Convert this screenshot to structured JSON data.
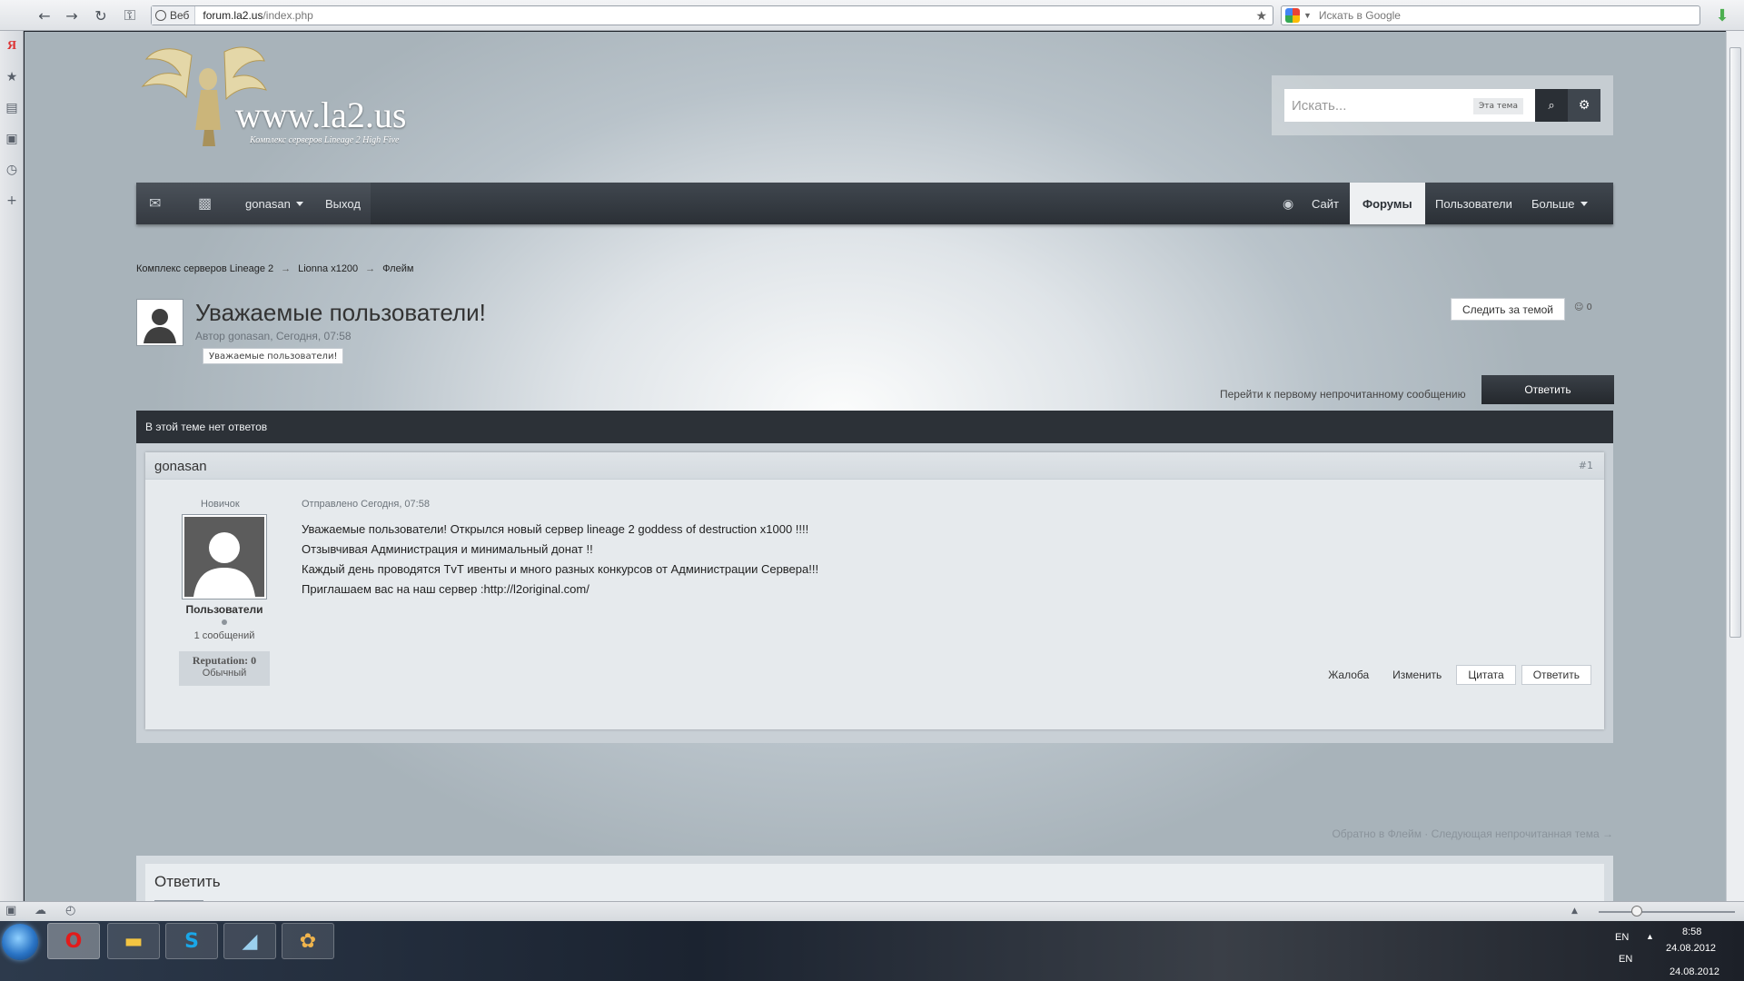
{
  "browser": {
    "address_badge": "Веб",
    "url_host": "forum.la2.us",
    "url_path": "/index.php",
    "search_placeholder": "Искать в Google",
    "star": "★"
  },
  "site": {
    "logo_title": "www.la2.us",
    "logo_subtitle": "Комплекс серверов Lineage 2 High Five",
    "search_placeholder": "Искать...",
    "search_scope": "Эта тема"
  },
  "nav": {
    "user": "gonasan",
    "logout": "Выход",
    "site": "Сайт",
    "forums": "Форумы",
    "users": "Пользователи",
    "more": "Больше"
  },
  "breadcrumb": [
    "Комплекс серверов Lineage 2",
    "Lionna x1200",
    "Флейм"
  ],
  "breadcrumb_sep": "→",
  "topic": {
    "title": "Уважаемые пользователи!",
    "meta": "Автор gonasan, Сегодня, 07:58",
    "tag": "Уважаемые пользователи!",
    "follow": "Следить за темой",
    "followers": "0",
    "unread_link": "Перейти к первому непрочитанному сообщению",
    "reply_button": "Ответить",
    "no_replies": "В этой теме нет ответов"
  },
  "post": {
    "author": "gonasan",
    "number": "#1",
    "rank": "Новичок",
    "group": "Пользователи",
    "posts_count": "1 сообщений",
    "reputation": "Reputation: 0",
    "reputation_level": "Обычный",
    "date": "Отправлено Сегодня, 07:58",
    "lines": [
      "Уважаемые пользователи! Открылся новый сервер lineage 2 goddess of destruction x1000 !!!!",
      "Отзывчивая Администрация и минимальный донат !!",
      "Каждый день проводятся TvT ивенты и много разных конкурсов от Администрации Сервера!!!",
      "Приглашаем вас на наш сервер :http://l2original.com/"
    ],
    "report": "Жалоба",
    "edit": "Изменить",
    "quote": "Цитата",
    "reply": "Ответить"
  },
  "footer_links": "Обратно в Флейм · Следующая непрочитанная тема →",
  "reply_section": {
    "title": "Ответить"
  },
  "taskbar": {
    "lang": "EN",
    "time": "8:58",
    "date": "24.08.2012",
    "lang2": "EN",
    "date2": "24.08.2012"
  }
}
